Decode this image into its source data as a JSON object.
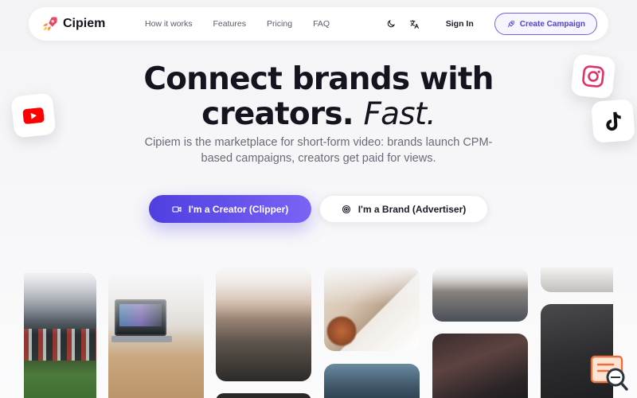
{
  "nav": {
    "brand": "Cipiem",
    "links": [
      "How it works",
      "Features",
      "Pricing",
      "FAQ"
    ],
    "sign_in": "Sign In",
    "create_campaign": "Create Campaign"
  },
  "hero": {
    "title_line1": "Connect brands with",
    "title_line2_plain": "creators.",
    "title_line2_accent": "Fast.",
    "subtitle": "Cipiem is the marketplace for short-form video: brands launch CPM-based campaigns, creators get paid for views."
  },
  "cta": {
    "creator": "I'm a Creator (Clipper)",
    "brand": "I'm a Brand (Advertiser)"
  },
  "icons": {
    "theme_toggle": "moon-icon",
    "language": "translate-icon",
    "create_campaign": "rocket-icon",
    "creator": "video-camera-icon",
    "brand": "target-icon"
  },
  "colors": {
    "accent": "#5b4bea",
    "youtube": "#ff0000",
    "instagram": "#e1306c",
    "tiktok": "#111111"
  }
}
